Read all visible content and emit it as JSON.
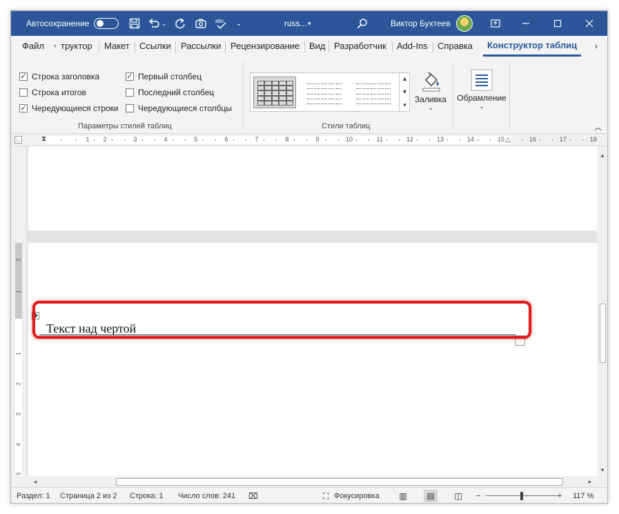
{
  "titlebar": {
    "autosave_label": "Автосохранение",
    "document_name": "russ...",
    "user_name": "Виктор Бухтеев",
    "icons": [
      "save-icon",
      "undo-icon",
      "redo-icon",
      "touch-mode-icon",
      "spelling-icon",
      "customize-icon",
      "search-icon"
    ]
  },
  "tabs": [
    {
      "label": "Файл"
    },
    {
      "label": "труктор"
    },
    {
      "label": "Макет"
    },
    {
      "label": "Ссылки"
    },
    {
      "label": "Рассылки"
    },
    {
      "label": "Рецензирование"
    },
    {
      "label": "Вид"
    },
    {
      "label": "Разработчик"
    },
    {
      "label": "Add-Ins"
    },
    {
      "label": "Справка"
    },
    {
      "label": "Конструктор таблиц",
      "active": true
    }
  ],
  "ribbon": {
    "options": [
      {
        "label": "Строка заголовка",
        "checked": true
      },
      {
        "label": "Строка итогов",
        "checked": false
      },
      {
        "label": "Чередующиеся строки",
        "checked": true
      },
      {
        "label": "Первый столбец",
        "checked": true
      },
      {
        "label": "Последний столбец",
        "checked": false
      },
      {
        "label": "Чередующиеся столбцы",
        "checked": false
      }
    ],
    "group_options_label": "Параметры стилей таблиц",
    "group_styles_label": "Стили таблиц",
    "shading_label": "Заливка",
    "borders_label": "Обрамление"
  },
  "document": {
    "text": "Текст над чертой"
  },
  "statusbar": {
    "section": "Раздел: 1",
    "page": "Страница 2 из 2",
    "line": "Строка: 1",
    "words": "Число слов: 241",
    "focus": "Фокусировка",
    "zoom": "117 %",
    "zoom_minus": "−",
    "zoom_plus": "+"
  },
  "ruler": {
    "h_numbers": [
      "1",
      "1",
      "2",
      "3",
      "4",
      "5",
      "6",
      "7",
      "8",
      "9",
      "10",
      "11",
      "12",
      "13",
      "14",
      "15",
      "16",
      "17",
      "18"
    ],
    "v_numbers": [
      "2",
      "1",
      "1",
      "2",
      "3",
      "4",
      "5"
    ]
  }
}
